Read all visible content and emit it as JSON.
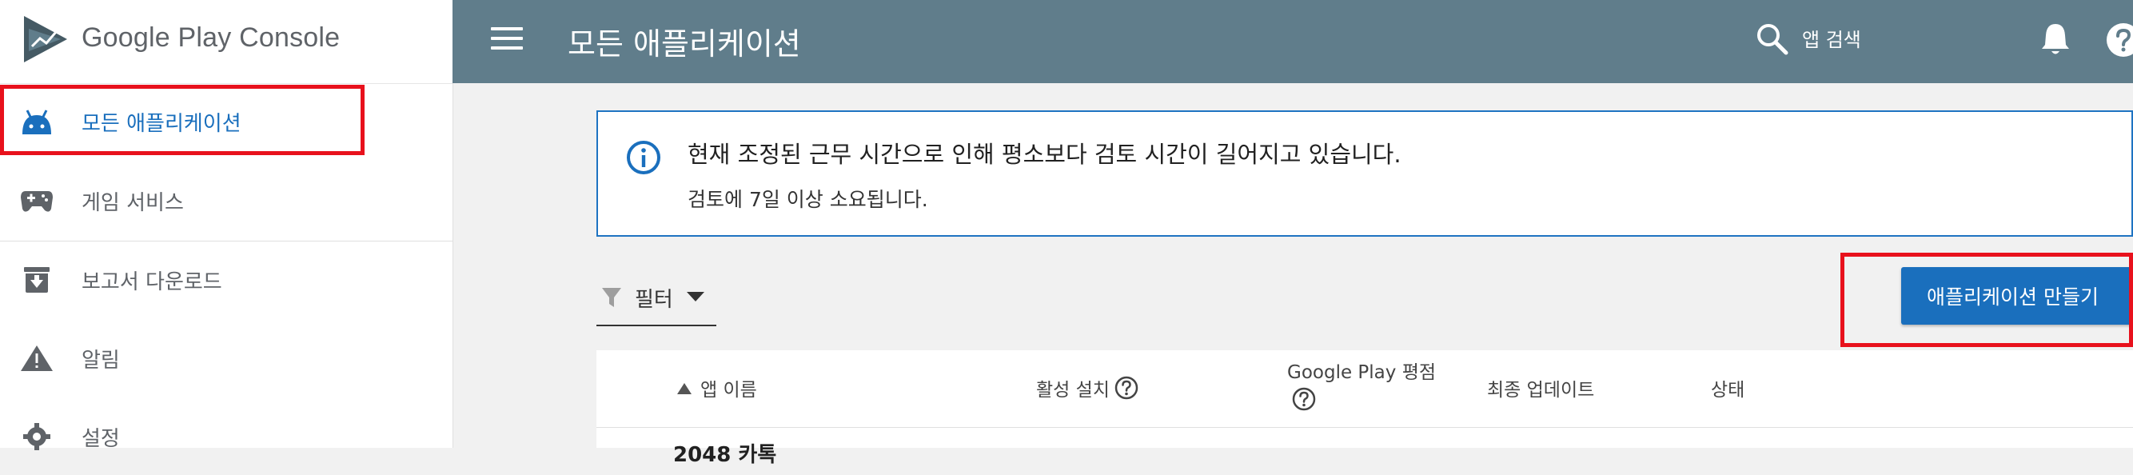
{
  "brand": {
    "google_play": "Google Play",
    "console": "Console"
  },
  "sidebar": {
    "items": [
      {
        "label": "모든 애플리케이션",
        "icon": "android-icon"
      },
      {
        "label": "게임 서비스",
        "icon": "gamepad-icon"
      },
      {
        "label": "보고서 다운로드",
        "icon": "download-box-icon"
      },
      {
        "label": "알림",
        "icon": "warning-icon"
      },
      {
        "label": "설정",
        "icon": "gear-icon"
      }
    ]
  },
  "topbar": {
    "title": "모든 애플리케이션",
    "search_placeholder": "앱 검색"
  },
  "notice": {
    "title": "현재 조정된 근무 시간으로 인해 평소보다 검토 시간이 길어지고 있습니다.",
    "body": "검토에 7일 이상 소요됩니다."
  },
  "toolbar": {
    "filter_label": "필터",
    "create_button": "애플리케이션 만들기"
  },
  "table": {
    "columns": {
      "app_name": "앱 이름",
      "active_installs": "활성 설치",
      "rating": "Google Play 평점",
      "last_update": "최종 업데이트",
      "status": "상태"
    },
    "rows": [
      {
        "app_name": "2048 카톡"
      }
    ]
  },
  "colors": {
    "topbar": "#607d8b",
    "accent": "#1a6fbd",
    "highlight": "#e8111c",
    "background": "#f1f1f1"
  }
}
